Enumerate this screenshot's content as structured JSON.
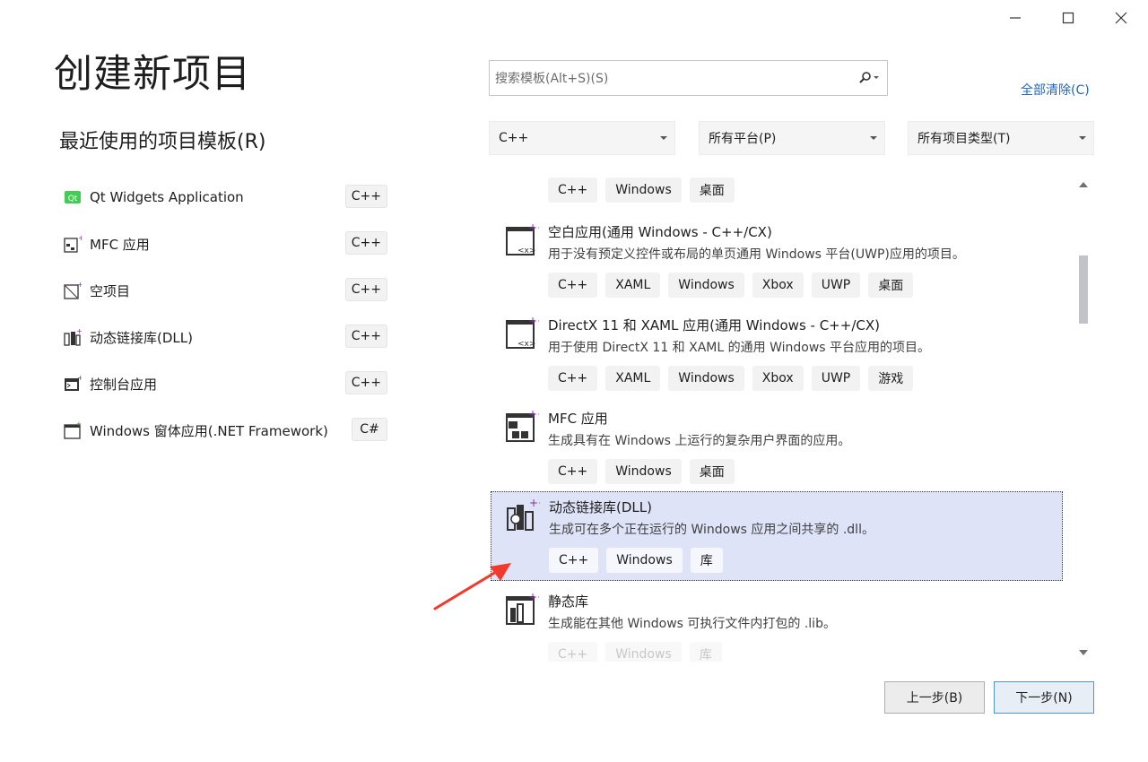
{
  "window": {
    "title": "创建新项目",
    "controls": [
      "minimize-icon",
      "maximize-icon",
      "close-icon"
    ]
  },
  "recent": {
    "title": "最近使用的项目模板(R)",
    "items": [
      {
        "label": "Qt Widgets Application",
        "badge": "C++",
        "icon": "qt-icon"
      },
      {
        "label": "MFC 应用",
        "badge": "C++",
        "icon": "mfc-app-icon"
      },
      {
        "label": "空项目",
        "badge": "C++",
        "icon": "empty-project-icon"
      },
      {
        "label": "动态链接库(DLL)",
        "badge": "C++",
        "icon": "dll-icon"
      },
      {
        "label": "控制台应用",
        "badge": "C++",
        "icon": "console-app-icon"
      },
      {
        "label": "Windows 窗体应用(.NET Framework)",
        "badge": "C#",
        "icon": "winforms-icon"
      }
    ]
  },
  "search": {
    "placeholder": "搜索模板(Alt+S)(S)",
    "clear_all": "全部清除(C)",
    "icon": "search-icon"
  },
  "filters": {
    "language": "C++",
    "platform": "所有平台(P)",
    "project_type": "所有项目类型(T)"
  },
  "templates": [
    {
      "name": "",
      "desc": "",
      "tags": [
        "C++",
        "Windows",
        "桌面"
      ],
      "partial": true
    },
    {
      "name": "空白应用(通用 Windows - C++/CX)",
      "desc": "用于没有预定义控件或布局的单页通用 Windows 平台(UWP)应用的项目。",
      "tags": [
        "C++",
        "XAML",
        "Windows",
        "Xbox",
        "UWP",
        "桌面"
      ],
      "icon": "uwp-blank-app-icon"
    },
    {
      "name": "DirectX 11 和 XAML 应用(通用 Windows - C++/CX)",
      "desc": "用于使用 DirectX 11 和 XAML 的通用 Windows 平台应用的项目。",
      "tags": [
        "C++",
        "XAML",
        "Windows",
        "Xbox",
        "UWP",
        "游戏"
      ],
      "icon": "directx-xaml-app-icon"
    },
    {
      "name": "MFC 应用",
      "desc": "生成具有在 Windows 上运行的复杂用户界面的应用。",
      "tags": [
        "C++",
        "Windows",
        "桌面"
      ],
      "icon": "mfc-app-icon"
    },
    {
      "name": "动态链接库(DLL)",
      "desc": "生成可在多个正在运行的 Windows 应用之间共享的 .dll。",
      "tags": [
        "C++",
        "Windows",
        "库"
      ],
      "icon": "dll-icon",
      "selected": true
    },
    {
      "name": "静态库",
      "desc": "生成能在其他 Windows 可执行文件内打包的 .lib。",
      "tags": [
        "C++",
        "Windows",
        "库"
      ],
      "icon": "static-lib-icon",
      "faded": true
    }
  ],
  "buttons": {
    "back": "上一步(B)",
    "next": "下一步(N)"
  },
  "colors": {
    "accent": "#1a66c6",
    "selected_bg": "#dfe3f8",
    "annotation_arrow": "#f23a2a",
    "icon_plus": "#8a2aa8"
  }
}
